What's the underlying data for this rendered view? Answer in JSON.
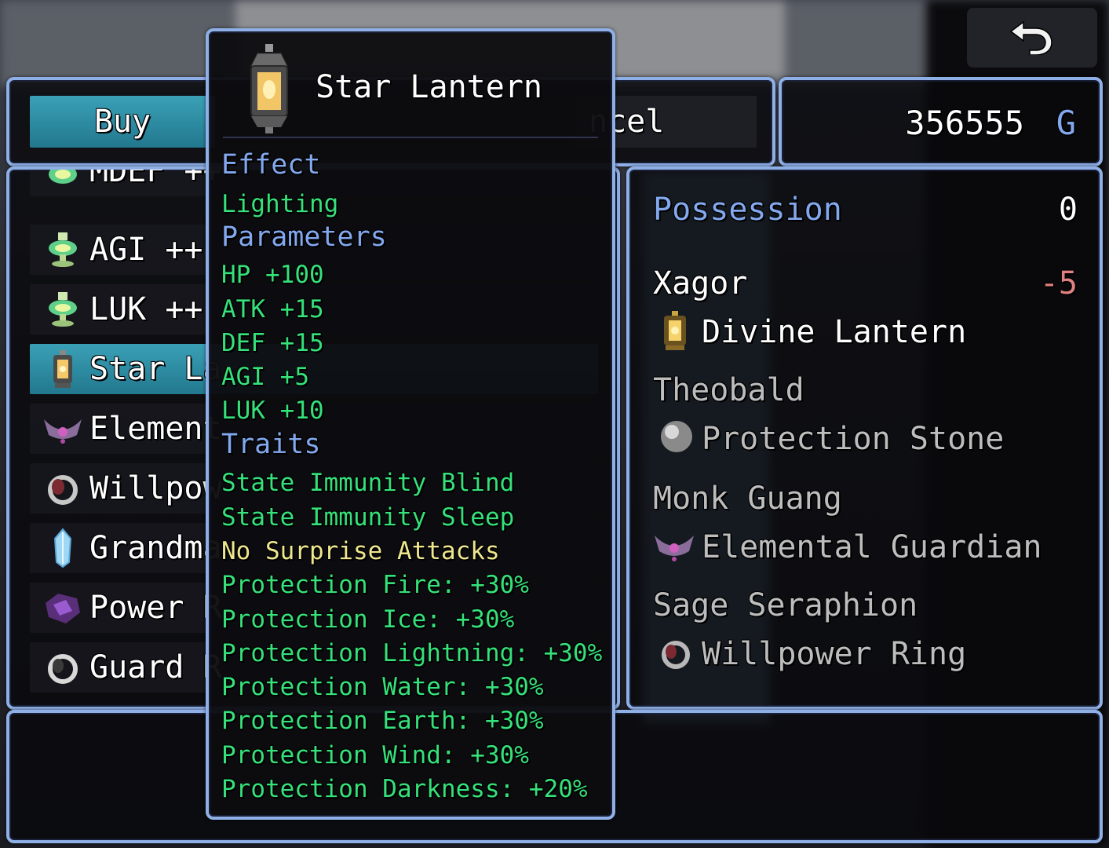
{
  "command": {
    "buy": "Buy",
    "cancel": "ncel"
  },
  "gold": {
    "value": "356555",
    "unit": "G"
  },
  "list": {
    "items": [
      {
        "label": "MDEF ++",
        "icon": "potion-icon"
      },
      {
        "label": "AGI ++",
        "icon": "potion-icon"
      },
      {
        "label": "LUK ++",
        "icon": "potion-icon"
      },
      {
        "label": "Star La",
        "icon": "lantern-icon"
      },
      {
        "label": "Element",
        "icon": "tiara-icon"
      },
      {
        "label": "Willpow",
        "icon": "ring-icon"
      },
      {
        "label": "Grandma",
        "icon": "crystal-icon"
      },
      {
        "label": "Power R",
        "icon": "gem-icon"
      },
      {
        "label": "Guard R",
        "icon": "ring-icon"
      }
    ]
  },
  "status": {
    "possession_label": "Possession",
    "possession_value": "0",
    "actors": [
      {
        "name": "Xagor",
        "change": "-5",
        "equip": "Divine Lantern",
        "icon": "lantern-icon"
      },
      {
        "name": "Theobald",
        "change": "",
        "equip": "Protection Stone",
        "icon": "orb-icon"
      },
      {
        "name": "Monk Guang",
        "change": "",
        "equip": "Elemental Guardian",
        "icon": "tiara-icon"
      },
      {
        "name": "Sage Seraphion",
        "change": "",
        "equip": "Willpower Ring",
        "icon": "ring-icon"
      }
    ]
  },
  "tooltip": {
    "title": "Star Lantern",
    "icon": "lantern-icon",
    "effect_header": "Effect",
    "effect": "Lighting",
    "params_header": "Parameters",
    "params": [
      "HP +100",
      "ATK +15",
      "DEF +15",
      "AGI +5",
      "LUK +10"
    ],
    "traits_header": "Traits",
    "traits": [
      "State Immunity Blind",
      "State Immunity Sleep",
      "No Surprise Attacks",
      "Protection Fire: +30%",
      "Protection Ice: +30%",
      "Protection Lightning: +30%",
      "Protection Water: +30%",
      "Protection Earth: +30%",
      "Protection Wind: +30%",
      "Protection Darkness: +20%"
    ]
  },
  "colors": {
    "system": "#83a8ee",
    "positive": "#36e07a",
    "special": "#efe790",
    "negative": "#e08080",
    "frame": "#8fb0e6"
  }
}
